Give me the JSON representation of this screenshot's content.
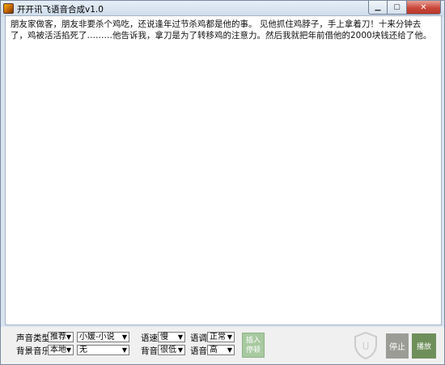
{
  "window": {
    "title": "开开讯飞语音合成v1.0"
  },
  "editor": {
    "text": "朋友家做客，朋友非要杀个鸡吃，还说逢年过节杀鸡都是他的事。 见他抓住鸡脖子，手上拿着刀！十来分钟去了，鸡被活活掐死了………他告诉我，拿刀是为了转移鸡的注意力。然后我就把年前借他的2000块钱还给了他。"
  },
  "controls": {
    "voice_type_label": "声音类型",
    "voice_category": "推荐",
    "voice_name": "小媛-小说",
    "bg_music_label": "背景音乐",
    "bg_source": "本地",
    "bg_track": "无",
    "speed_label": "语速",
    "speed_value": "慢",
    "tone_label": "语调",
    "tone_value": "正常",
    "bg_volume_label": "背音",
    "bg_volume_value": "很低",
    "voice_volume_label": "语音",
    "voice_volume_value": "高",
    "insert_pause_label_1": "插入",
    "insert_pause_label_2": "停顿",
    "stop_label": "停止",
    "play_label": "播放"
  }
}
